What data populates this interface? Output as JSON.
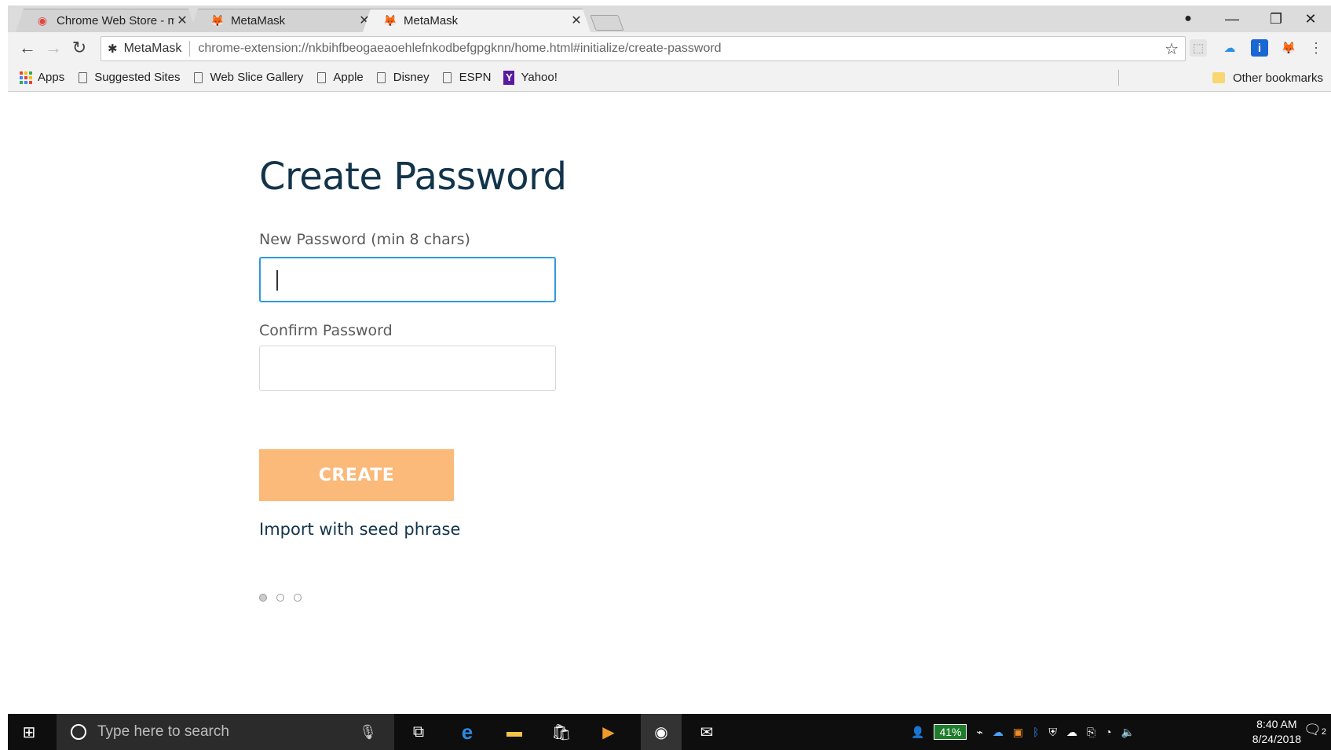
{
  "browser": {
    "tabs": [
      {
        "title": "Chrome Web Store - met",
        "favicon": "chrome-web-store-icon",
        "active": false
      },
      {
        "title": "MetaMask",
        "favicon": "metamask-fox-icon",
        "active": false
      },
      {
        "title": "MetaMask",
        "favicon": "metamask-fox-icon",
        "active": true
      }
    ],
    "close_glyph": "✕",
    "window_controls": {
      "minimize": "—",
      "restore": "❐",
      "close": "✕"
    },
    "omnibox": {
      "site_name": "MetaMask",
      "url": "chrome-extension://nkbihfbeogaeaoehlefnkodbefgpgknn/home.html#initialize/create-password"
    },
    "bookmarks": [
      {
        "label": "Apps",
        "icon": "apps-grid-icon"
      },
      {
        "label": "Suggested Sites",
        "icon": "page-icon"
      },
      {
        "label": "Web Slice Gallery",
        "icon": "page-icon"
      },
      {
        "label": "Apple",
        "icon": "page-icon"
      },
      {
        "label": "Disney",
        "icon": "page-icon"
      },
      {
        "label": "ESPN",
        "icon": "page-icon"
      },
      {
        "label": "Yahoo!",
        "icon": "yahoo-icon"
      }
    ],
    "other_bookmarks": "Other bookmarks"
  },
  "page": {
    "title": "Create Password",
    "new_password_label": "New Password (min 8 chars)",
    "new_password_value": "",
    "confirm_password_label": "Confirm Password",
    "confirm_password_value": "",
    "create_button": "CREATE",
    "import_link": "Import with seed phrase",
    "step_current": 1,
    "step_total": 3,
    "colors": {
      "title": "#12344b",
      "button": "#fbb97a",
      "focus_border": "#3098dc"
    }
  },
  "taskbar": {
    "search_placeholder": "Type here to search",
    "battery": "41%",
    "time": "8:40 AM",
    "date": "8/24/2018",
    "notification_count": "2"
  }
}
